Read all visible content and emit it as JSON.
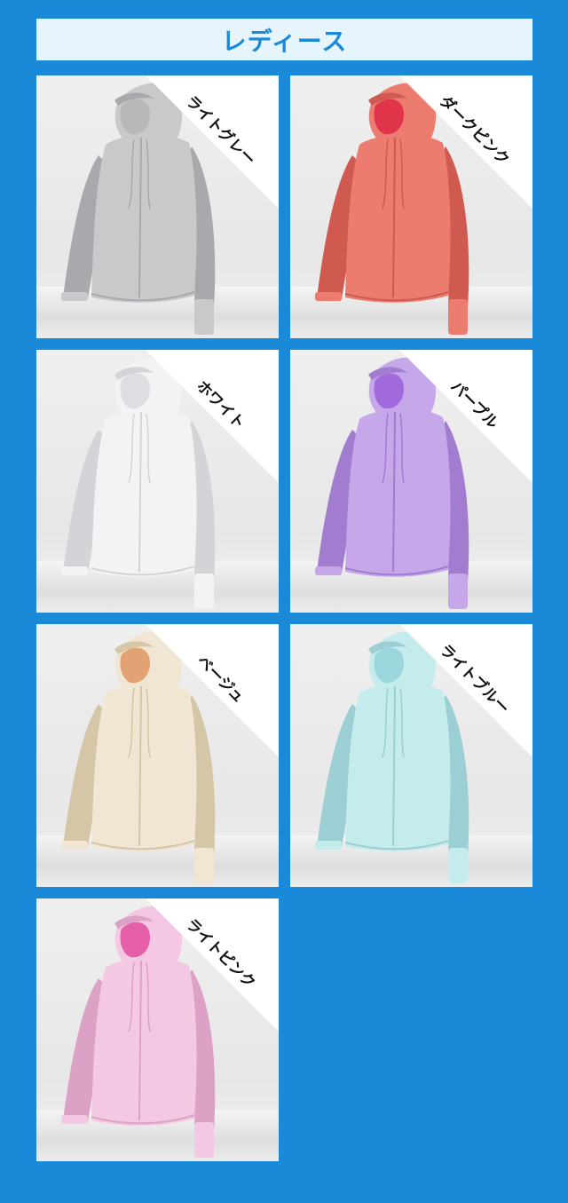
{
  "header": {
    "title": "レディース"
  },
  "items": [
    {
      "label": "ライトグレー",
      "icon": "hoodie-icon",
      "color": "#c9c9cc",
      "shade": "#a9a9ad",
      "lining": "#b8b8bb"
    },
    {
      "label": "ダークピンク",
      "icon": "hoodie-icon",
      "color": "#ec7c70",
      "shade": "#d05a50",
      "lining": "#e0344a"
    },
    {
      "label": "ホワイト",
      "icon": "hoodie-icon",
      "color": "#f3f3f5",
      "shade": "#d4d4d8",
      "lining": "#dedee2"
    },
    {
      "label": "パープル",
      "icon": "hoodie-icon",
      "color": "#c6a7ea",
      "shade": "#a17ccf",
      "lining": "#a06adc"
    },
    {
      "label": "ベージュ",
      "icon": "hoodie-icon",
      "color": "#f1e6d3",
      "shade": "#d6c6a8",
      "lining": "#e2a273"
    },
    {
      "label": "ライトブルー",
      "icon": "hoodie-icon",
      "color": "#c5ecec",
      "shade": "#9ccfd3",
      "lining": "#9ad6dc"
    },
    {
      "label": "ライトピンク",
      "icon": "hoodie-icon",
      "color": "#f4c7e2",
      "shade": "#dba2c6",
      "lining": "#e55fa8"
    }
  ]
}
